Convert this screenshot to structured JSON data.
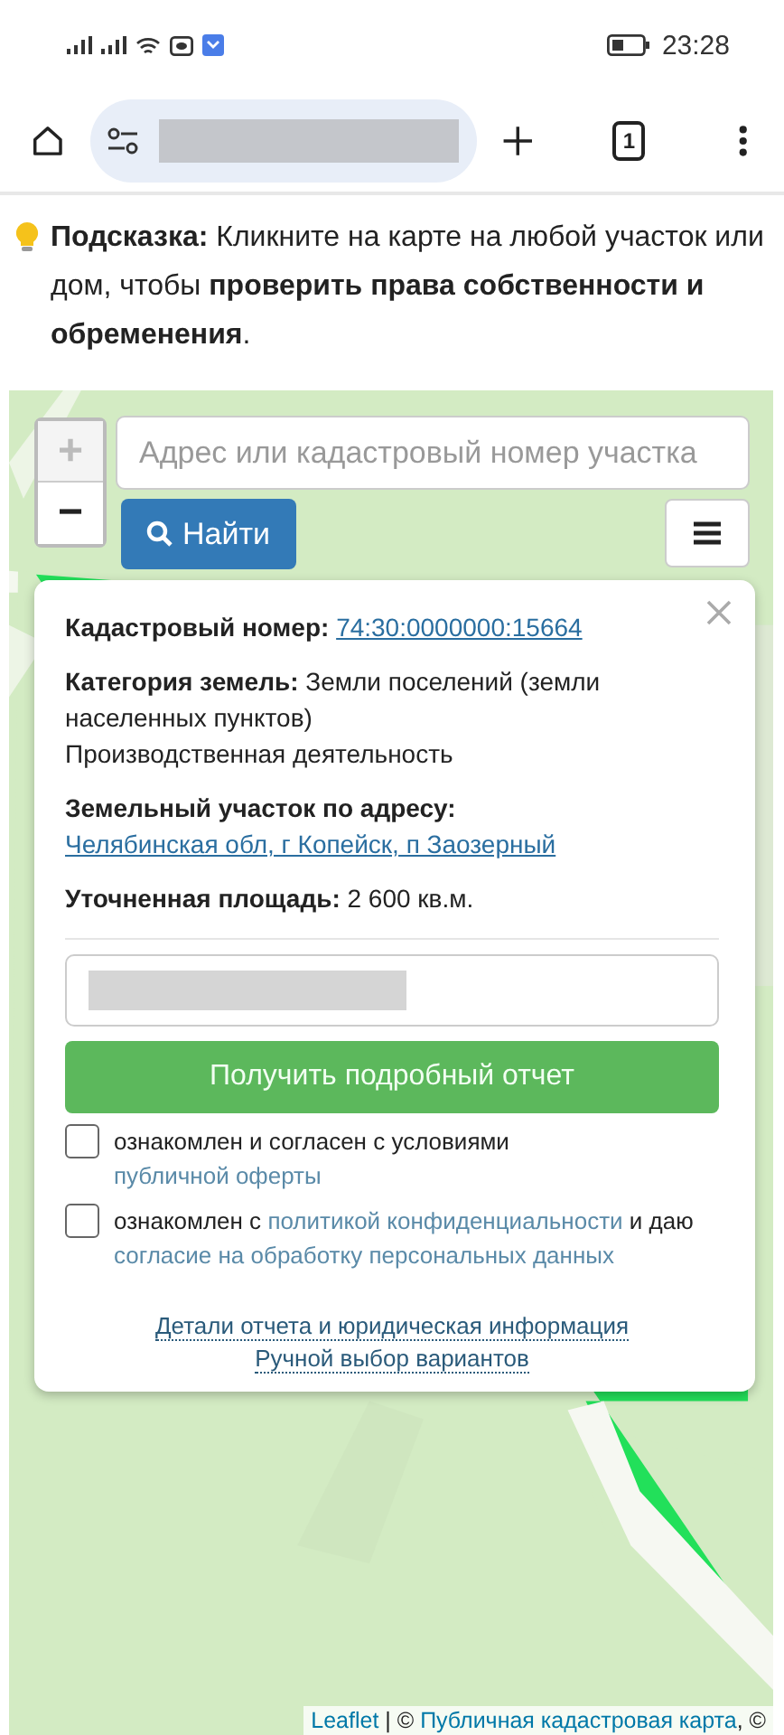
{
  "status_bar": {
    "time": "23:28"
  },
  "browser": {
    "tab_count": "1"
  },
  "hint": {
    "text": "**Подсказка:** Кликните на карте на любой участок или дом, чтобы **проверить права собственности и обременения**."
  },
  "map": {
    "zoom_in": "+",
    "zoom_out": "−",
    "search": {
      "placeholder": "Адрес или кадастровый номер участка"
    },
    "find_button": "Найти",
    "popup": {
      "rows": [
        {
          "label": "Кадастровый номер:",
          "link": "74:30:0000000:15664"
        },
        {
          "label": "Категория земель:",
          "value": "Земли поселений (земли населенных пунктов)",
          "note": "Производственная деятельность"
        },
        {
          "label": "Земельный участок по адресу:",
          "link": "Челябинская обл, г Копейск, п Заозерный"
        },
        {
          "label": "Уточненная площадь:",
          "value": "2 600 кв.м."
        }
      ],
      "report_button": "Получить подробный отчет",
      "agreements": [
        {
          "checked": false,
          "parts": [
            {
              "text": "ознакомлен и согласен с условиями "
            },
            {
              "link": "публичной оферты"
            }
          ]
        },
        {
          "checked": false,
          "parts": [
            {
              "text": "ознакомлен с "
            },
            {
              "link": "политикой конфиденциальности"
            },
            {
              "text": " и даю "
            },
            {
              "link": "согласие на обработку персональных данных"
            }
          ]
        }
      ],
      "links": [
        "Детали отчета и юридическая информация",
        "Ручной выбор вариантов"
      ]
    },
    "attribution": [
      {
        "link": "Leaflet"
      },
      {
        "text": " | © "
      },
      {
        "link": "Публичная кадастровая карта"
      },
      {
        "text": ", ©"
      }
    ]
  }
}
